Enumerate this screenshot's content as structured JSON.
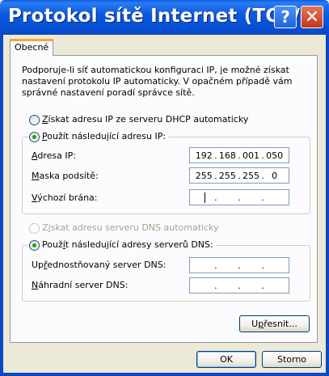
{
  "window": {
    "title": "Protokol sítě Internet (TCP/...",
    "help_glyph": "?",
    "close_glyph": "✕"
  },
  "tabs": [
    {
      "label": "Obecné",
      "selected": true
    }
  ],
  "intro": "Podporuje-li síť automatickou konfiguraci IP, je možné získat nastavení protokolu IP automaticky. V opačném případě vám správné nastavení poradí správce sítě.",
  "ip_section": {
    "auto_radio": {
      "label_pre": "",
      "mnemonic": "Z",
      "label_post": "ískat adresu IP ze serveru DHCP automaticky",
      "checked": false
    },
    "manual_radio": {
      "label_pre": "",
      "mnemonic": "P",
      "label_post": "oužít následující adresu IP:",
      "checked": true
    },
    "fields": [
      {
        "label_pre": "",
        "mnemonic": "A",
        "label_post": "dresa IP:",
        "octets": [
          "192",
          "168",
          "001",
          "050"
        ]
      },
      {
        "label_pre": "",
        "mnemonic": "M",
        "label_post": "aska podsítě:",
        "octets": [
          "255",
          "255",
          "255",
          "0"
        ]
      },
      {
        "label_pre": "",
        "mnemonic": "V",
        "label_post": "ýchozí brána:",
        "octets": [
          "",
          "",
          "",
          ""
        ]
      }
    ]
  },
  "dns_section": {
    "auto_radio": {
      "label_pre": "Z",
      "mnemonic": "í",
      "label_post": "skat adresu serveru DNS automaticky",
      "checked": false,
      "disabled": true
    },
    "manual_radio": {
      "label_pre": "Použ",
      "mnemonic": "í",
      "label_post": "t následující adresy serverů DNS:",
      "checked": true
    },
    "fields": [
      {
        "label_pre": "Up",
        "mnemonic": "ř",
        "label_post": "ednostňovaný server DNS:",
        "octets": [
          "",
          "",
          "",
          ""
        ]
      },
      {
        "label_pre": "",
        "mnemonic": "N",
        "label_post": "áhradní server DNS:",
        "octets": [
          "",
          "",
          "",
          ""
        ]
      }
    ]
  },
  "buttons": {
    "advanced": {
      "label_pre": "U",
      "mnemonic": "p",
      "label_post": "řesnit..."
    },
    "ok": "OK",
    "cancel": "Storno"
  },
  "colors": {
    "titlebar": "#0a5ae0",
    "tab_highlight": "#f6a53b",
    "radio_dot": "#21a121",
    "face": "#ece9d8"
  }
}
